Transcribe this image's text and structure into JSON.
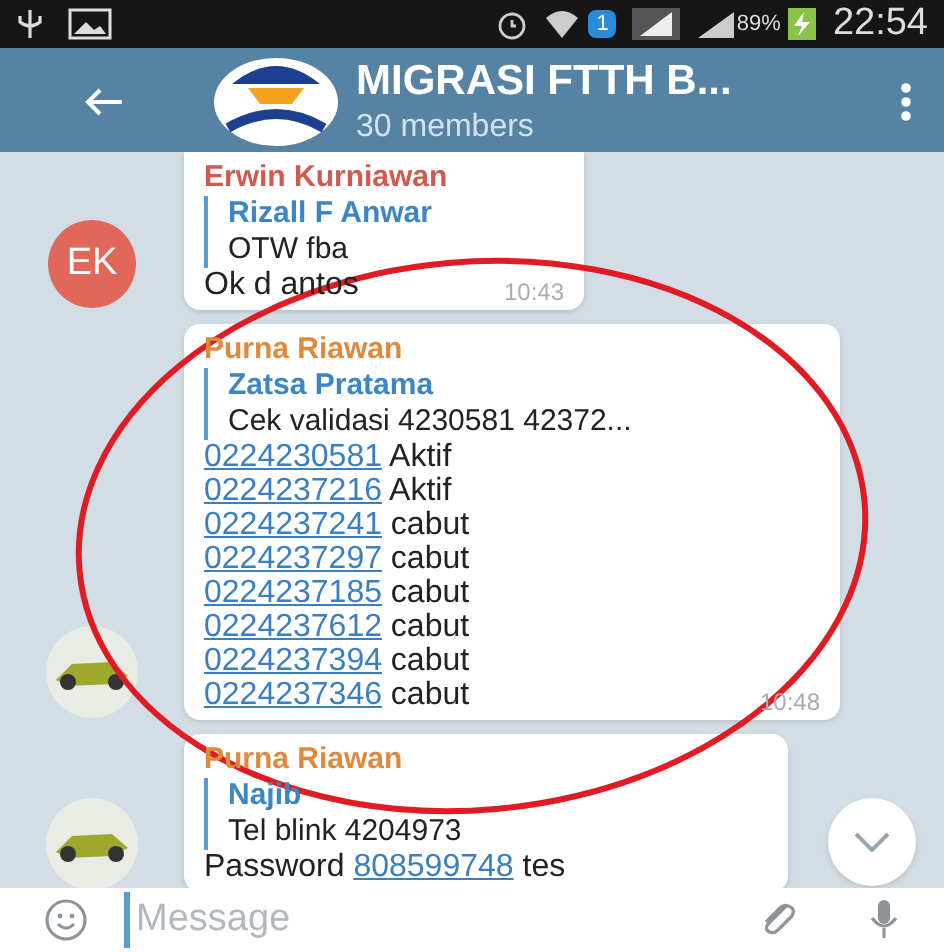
{
  "status_bar": {
    "notification_count": "1",
    "battery": "89%",
    "time": "22:54"
  },
  "header": {
    "title": "MIGRASI FTTH B...",
    "subtitle": "30 members"
  },
  "messages": [
    {
      "sender": "Erwin Kurniawan",
      "color": "#cf5a4f",
      "avatar": {
        "kind": "initials",
        "text": "EK",
        "color": "#e0675a"
      },
      "reply": {
        "author": "Rizall F Anwar",
        "text": "OTW fba"
      },
      "lines": [
        [
          {
            "text": "Ok d antos",
            "link": false
          }
        ]
      ],
      "time": "10:43"
    },
    {
      "sender": "Purna Riawan",
      "color": "#de8a3e",
      "avatar": {
        "kind": "photo"
      },
      "reply": {
        "author": "Zatsa Pratama",
        "text": "Cek validasi 4230581 42372..."
      },
      "lines": [
        [
          {
            "text": "0224230581",
            "link": true
          },
          {
            "text": " Aktif",
            "link": false
          }
        ],
        [
          {
            "text": "0224237216",
            "link": true
          },
          {
            "text": " Aktif",
            "link": false
          }
        ],
        [
          {
            "text": "0224237241",
            "link": true
          },
          {
            "text": " cabut",
            "link": false
          }
        ],
        [
          {
            "text": "0224237297",
            "link": true
          },
          {
            "text": " cabut",
            "link": false
          }
        ],
        [
          {
            "text": "0224237185",
            "link": true
          },
          {
            "text": " cabut",
            "link": false
          }
        ],
        [
          {
            "text": "0224237612",
            "link": true
          },
          {
            "text": " cabut",
            "link": false
          }
        ],
        [
          {
            "text": "0224237394",
            "link": true
          },
          {
            "text": " cabut",
            "link": false
          }
        ],
        [
          {
            "text": "0224237346",
            "link": true
          },
          {
            "text": " cabut",
            "link": false
          }
        ]
      ],
      "time": "10:48"
    },
    {
      "sender": "Purna Riawan",
      "color": "#de8a3e",
      "avatar": {
        "kind": "photo"
      },
      "reply": {
        "author": "Najib",
        "text": "Tel blink 4204973"
      },
      "lines": [
        [
          {
            "text": "Password ",
            "link": false
          },
          {
            "text": "808599748",
            "link": true
          },
          {
            "text": " tes",
            "link": false
          }
        ]
      ]
    }
  ],
  "composer": {
    "placeholder": "Message"
  }
}
